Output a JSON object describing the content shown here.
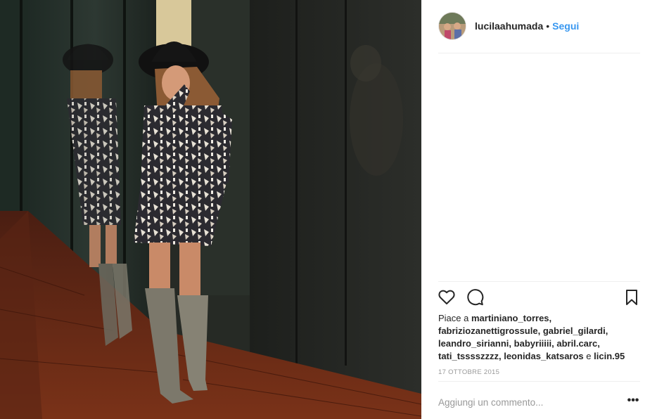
{
  "post": {
    "username": "lucilaahumada",
    "separator": "•",
    "follow_label": "Segui",
    "likes_prefix": "Piace a",
    "liked_by": [
      "martiniano_torres,",
      "fabriziozanettigrossule,",
      "gabriel_gilardi,",
      "leandro_sirianni,",
      "babyriiiii,",
      "abril.carc,",
      "tati_tsssszzzz,",
      "leonidas_katsaros"
    ],
    "likes_joiner": "e",
    "likes_last": "licin.95",
    "date": "17 OTTOBRE 2015",
    "comment_placeholder": "Aggiungi un commento...",
    "more_label": "•••"
  },
  "icons": {
    "like": "heart-icon",
    "comment": "speech-bubble-icon",
    "save": "bookmark-icon",
    "more": "ellipsis-icon"
  },
  "colors": {
    "link_blue": "#3897f0",
    "text": "#262626",
    "muted": "#999999",
    "divider": "#efefef"
  }
}
